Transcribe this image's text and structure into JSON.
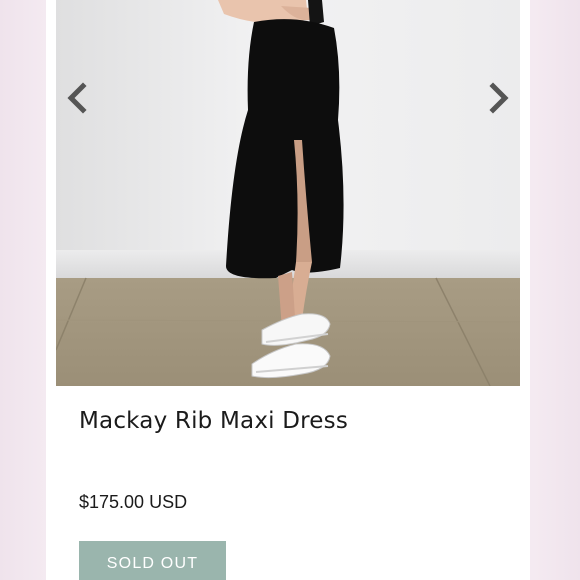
{
  "product": {
    "title": "Mackay Rib Maxi Dress",
    "price": "$175.00 USD",
    "button_label": "SOLD OUT"
  },
  "gallery": {
    "prev_icon": "chevron-left-icon",
    "next_icon": "chevron-right-icon"
  },
  "colors": {
    "page_background": "#f4eaf1",
    "button": "#9ab5ad",
    "arrow": "#555555"
  }
}
